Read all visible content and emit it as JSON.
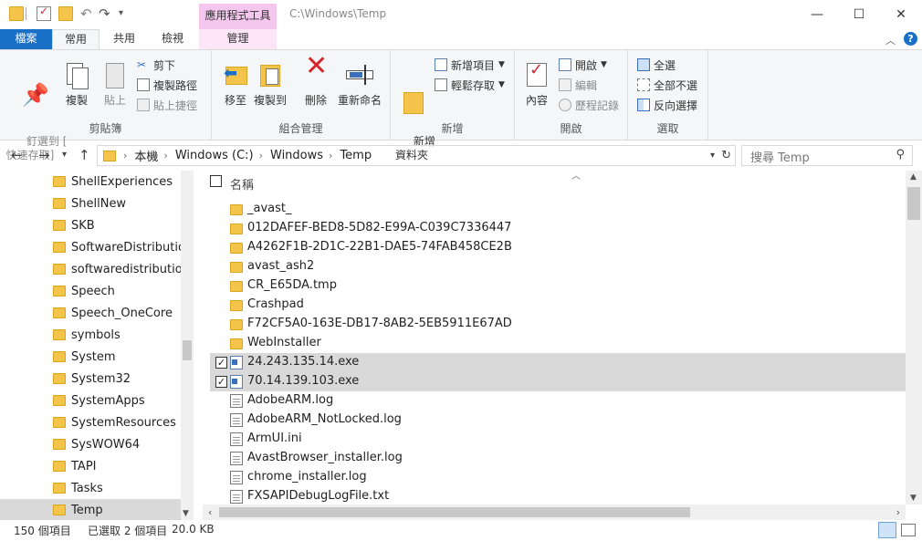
{
  "window": {
    "title": "C:\\Windows\\Temp",
    "context_tab": "應用程式工具",
    "minimize": "—",
    "maximize": "☐",
    "close": "✕"
  },
  "tabs": [
    {
      "label": "檔案"
    },
    {
      "label": "常用"
    },
    {
      "label": "共用"
    },
    {
      "label": "檢視"
    },
    {
      "label": "管理"
    }
  ],
  "ribbon": {
    "clipboard": {
      "pin": "釘選到 [\n快速存取]",
      "copy": "複製",
      "paste": "貼上",
      "cut": "剪下",
      "copy_path": "複製路徑",
      "paste_shortcut": "貼上捷徑",
      "label": "剪貼簿"
    },
    "organize": {
      "move_to": "移至",
      "copy_to": "複製到",
      "delete": "刪除",
      "rename": "重新命名",
      "label": "組合管理"
    },
    "new": {
      "new_folder": "新增\n資料夾",
      "new_item": "新增項目",
      "easy_access": "輕鬆存取",
      "label": "新增"
    },
    "open": {
      "properties": "內容",
      "open": "開啟",
      "edit": "編輯",
      "history": "歷程記錄",
      "label": "開啟"
    },
    "select": {
      "select_all": "全選",
      "select_none": "全部不選",
      "invert": "反向選擇",
      "label": "選取"
    }
  },
  "address": {
    "crumbs": [
      "本機",
      "Windows (C:)",
      "Windows",
      "Temp"
    ],
    "search_placeholder": "搜尋 Temp"
  },
  "nav_items": [
    {
      "label": "ShellExperiences"
    },
    {
      "label": "ShellNew"
    },
    {
      "label": "SKB"
    },
    {
      "label": "SoftwareDistribution"
    },
    {
      "label": "softwaredistribution.b"
    },
    {
      "label": "Speech"
    },
    {
      "label": "Speech_OneCore"
    },
    {
      "label": "symbols"
    },
    {
      "label": "System"
    },
    {
      "label": "System32"
    },
    {
      "label": "SystemApps"
    },
    {
      "label": "SystemResources"
    },
    {
      "label": "SysWOW64"
    },
    {
      "label": "TAPI"
    },
    {
      "label": "Tasks"
    },
    {
      "label": "Temp",
      "selected": true
    }
  ],
  "list": {
    "column_name": "名稱",
    "files": [
      {
        "name": "_avast_",
        "type": "folder"
      },
      {
        "name": "012DAFEF-BED8-5D82-E99A-C039C7336447",
        "type": "folder"
      },
      {
        "name": "A4262F1B-2D1C-22B1-DAE5-74FAB458CE2B",
        "type": "folder"
      },
      {
        "name": "avast_ash2",
        "type": "folder"
      },
      {
        "name": "CR_E65DA.tmp",
        "type": "folder"
      },
      {
        "name": "Crashpad",
        "type": "folder"
      },
      {
        "name": "F72CF5A0-163E-DB17-8AB2-5EB5911E67AD",
        "type": "folder"
      },
      {
        "name": "WebInstaller",
        "type": "folder"
      },
      {
        "name": "24.243.135.14.exe",
        "type": "exe",
        "selected": true
      },
      {
        "name": "70.14.139.103.exe",
        "type": "exe",
        "selected": true
      },
      {
        "name": "AdobeARM.log",
        "type": "doc"
      },
      {
        "name": "AdobeARM_NotLocked.log",
        "type": "doc"
      },
      {
        "name": "ArmUI.ini",
        "type": "doc"
      },
      {
        "name": "AvastBrowser_installer.log",
        "type": "doc"
      },
      {
        "name": "chrome_installer.log",
        "type": "doc"
      },
      {
        "name": "FXSAPIDebugLogFile.txt",
        "type": "txt"
      }
    ]
  },
  "status": {
    "count": "150 個項目",
    "selected": "已選取 2 個項目",
    "size": "20.0 KB"
  },
  "colors": {
    "file_tab": "#1a6fc6",
    "context_tab": "#f5c7ee",
    "folder": "#f4c54a",
    "selection": "#d9d9d9",
    "delete_red": "#d4262c"
  }
}
